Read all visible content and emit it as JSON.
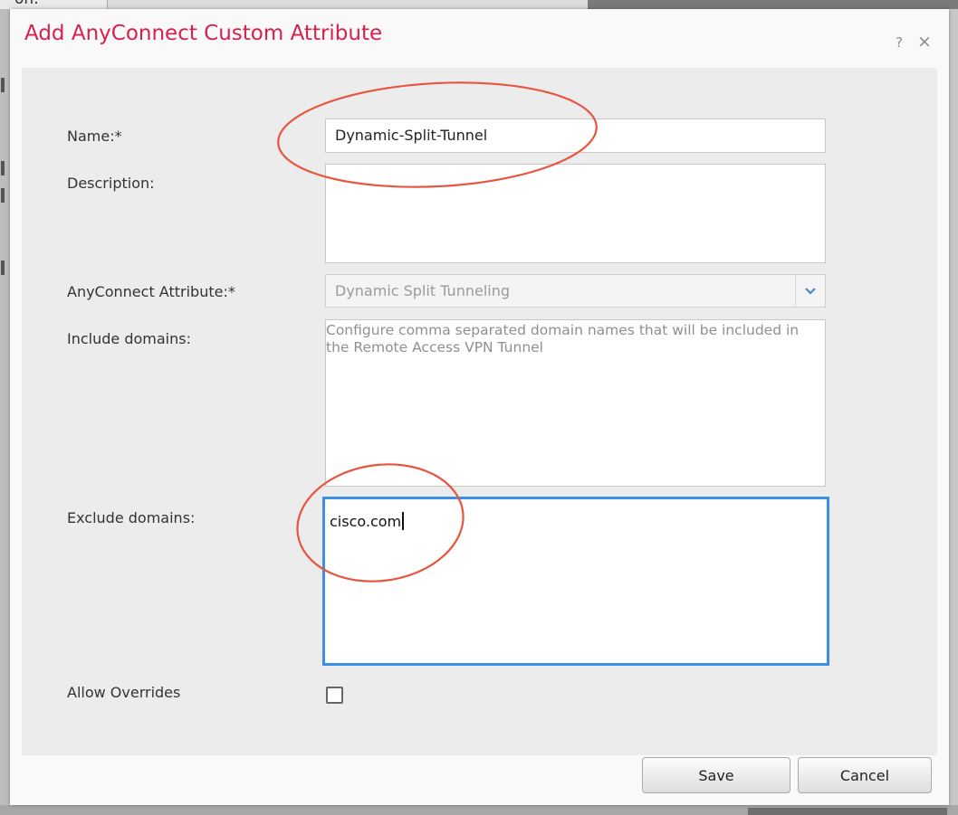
{
  "background": {
    "partial_text": "on:"
  },
  "dialog": {
    "title": "Add AnyConnect Custom Attribute",
    "help_label": "?",
    "close_label": "×",
    "title_color": "#d8204d"
  },
  "form": {
    "name": {
      "label": "Name:*",
      "value": "Dynamic-Split-Tunnel"
    },
    "description": {
      "label": "Description:",
      "value": ""
    },
    "anyconnect_attribute": {
      "label": "AnyConnect Attribute:*",
      "selected": "Dynamic Split Tunneling"
    },
    "include_domains": {
      "label": "Include domains:",
      "placeholder": "Configure comma separated domain names that will be included in the Remote Access VPN Tunnel"
    },
    "exclude_domains": {
      "label": "Exclude domains:",
      "value": "cisco.com"
    },
    "allow_overrides": {
      "label": "Allow Overrides",
      "checked": false
    }
  },
  "buttons": {
    "save": "Save",
    "cancel": "Cancel"
  },
  "annotation_color": "#e8553f"
}
